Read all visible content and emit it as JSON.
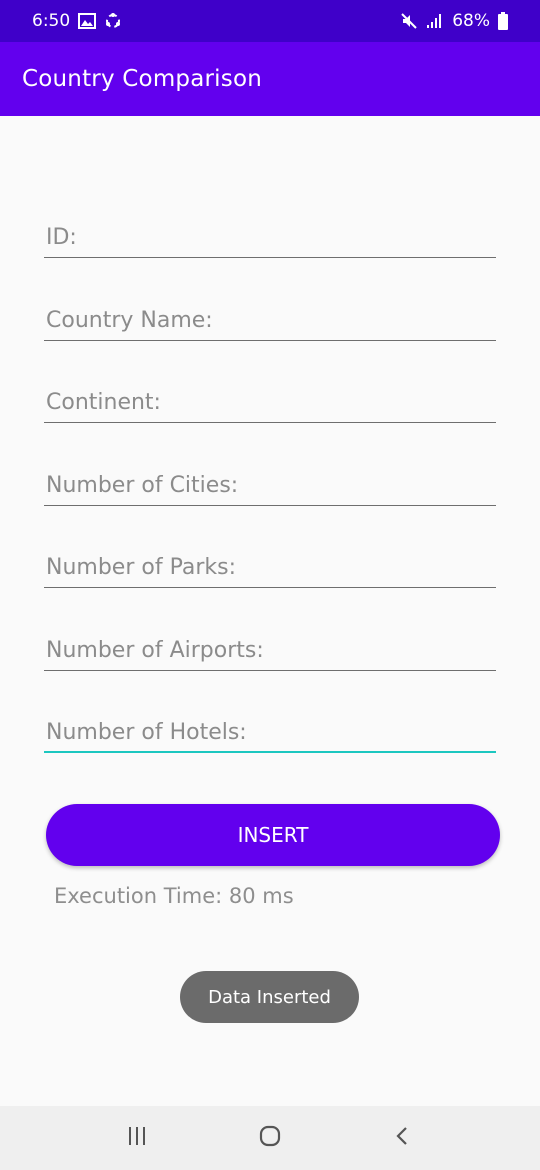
{
  "status_bar": {
    "time": "6:50",
    "battery": "68%",
    "icons": [
      "image-icon",
      "sync-icon",
      "mute-icon",
      "signal-icon",
      "battery-icon"
    ]
  },
  "app_bar": {
    "title": "Country Comparison"
  },
  "form": {
    "fields": [
      {
        "placeholder": "ID:",
        "value": ""
      },
      {
        "placeholder": "Country Name:",
        "value": ""
      },
      {
        "placeholder": "Continent:",
        "value": ""
      },
      {
        "placeholder": "Number of Cities:",
        "value": ""
      },
      {
        "placeholder": "Number of Parks:",
        "value": ""
      },
      {
        "placeholder": "Number of Airports:",
        "value": ""
      },
      {
        "placeholder": "Number of Hotels:",
        "value": ""
      }
    ],
    "insert_label": "INSERT",
    "execution_time": "Execution Time: 80 ms"
  },
  "toast": {
    "message": "Data Inserted"
  },
  "nav_bar": {
    "icons": [
      "recents-icon",
      "home-icon",
      "back-icon"
    ]
  },
  "colors": {
    "primary": "#6200ee",
    "status_bar": "#3f00c9",
    "focus_accent": "#1cc7c0",
    "toast": "#6b6b6b"
  }
}
